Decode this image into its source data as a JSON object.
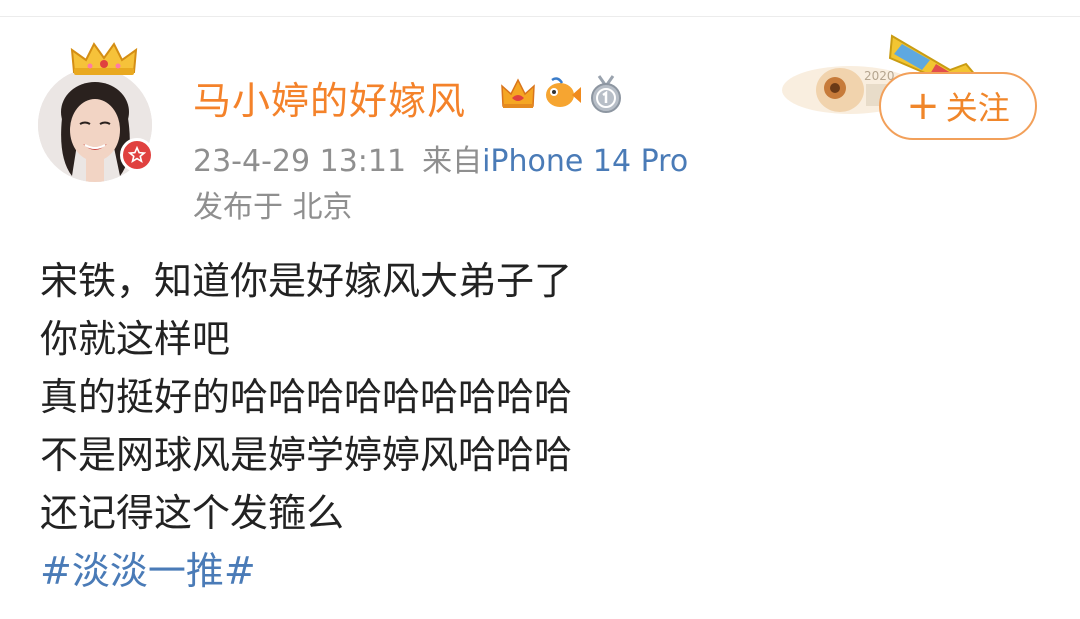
{
  "user": {
    "name": "马小婷的好嫁风",
    "badges": [
      "crown-badge-icon",
      "fish-badge-icon",
      "medal-badge-icon"
    ]
  },
  "meta": {
    "time": "23-4-29 13:11",
    "source_prefix": "来自",
    "source": "iPhone 14 Pro",
    "location": "发布于 北京"
  },
  "follow": {
    "plus": "+",
    "label": "关注"
  },
  "post": {
    "lines": [
      "宋铁，知道你是好嫁风大弟子了",
      "你就这样吧",
      "真的挺好的哈哈哈哈哈哈哈哈哈",
      "不是网球风是婷学婷婷风哈哈哈",
      "还记得这个发箍么"
    ],
    "hashtag": "#淡淡一推#"
  },
  "colors": {
    "username": "#f4822a",
    "link": "#4a7bb7",
    "meta": "#8f8f8f",
    "follow_border": "#f2a05a"
  }
}
